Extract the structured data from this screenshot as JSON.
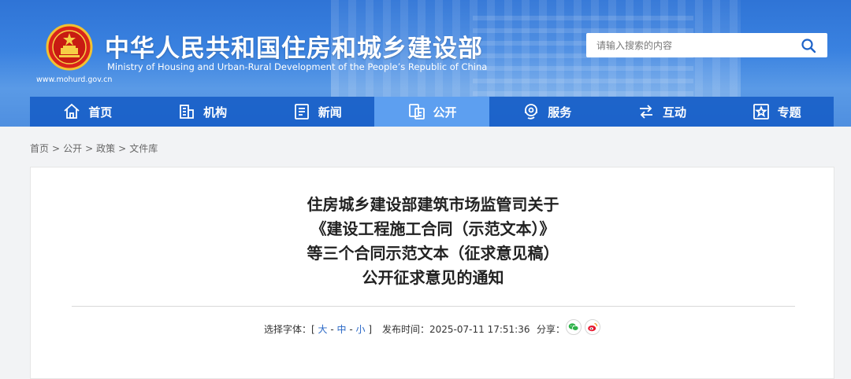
{
  "header": {
    "title": "中华人民共和国住房和城乡建设部",
    "subtitle": "Ministry of Housing and Urban-Rural Development of the People’s Republic of China",
    "url": "www.mohurd.gov.cn",
    "search_placeholder": "请输入搜索的内容",
    "accent_color": "#1e63c8"
  },
  "nav": [
    {
      "label": "首页",
      "icon": "home-icon"
    },
    {
      "label": "机构",
      "icon": "building-icon"
    },
    {
      "label": "新闻",
      "icon": "news-icon"
    },
    {
      "label": "公开",
      "icon": "document-icon",
      "active": true
    },
    {
      "label": "服务",
      "icon": "service-icon"
    },
    {
      "label": "互动",
      "icon": "interaction-icon"
    },
    {
      "label": "专题",
      "icon": "star-icon"
    }
  ],
  "breadcrumb": [
    "首页",
    "公开",
    "政策",
    "文件库"
  ],
  "article": {
    "title_lines": [
      "住房城乡建设部建筑市场监管司关于",
      "《建设工程施工合同（示范文本）》",
      "等三个合同示范文本（征求意见稿）",
      "公开征求意见的通知"
    ],
    "font_label": "选择字体：",
    "font_open": "[",
    "font_large": "大",
    "font_mid": "中",
    "font_small": "小",
    "font_dash": "-",
    "font_close": "]",
    "publish_label": "发布时间：",
    "publish_time": "2025-07-11 17:51:36",
    "share_label": "分享："
  }
}
